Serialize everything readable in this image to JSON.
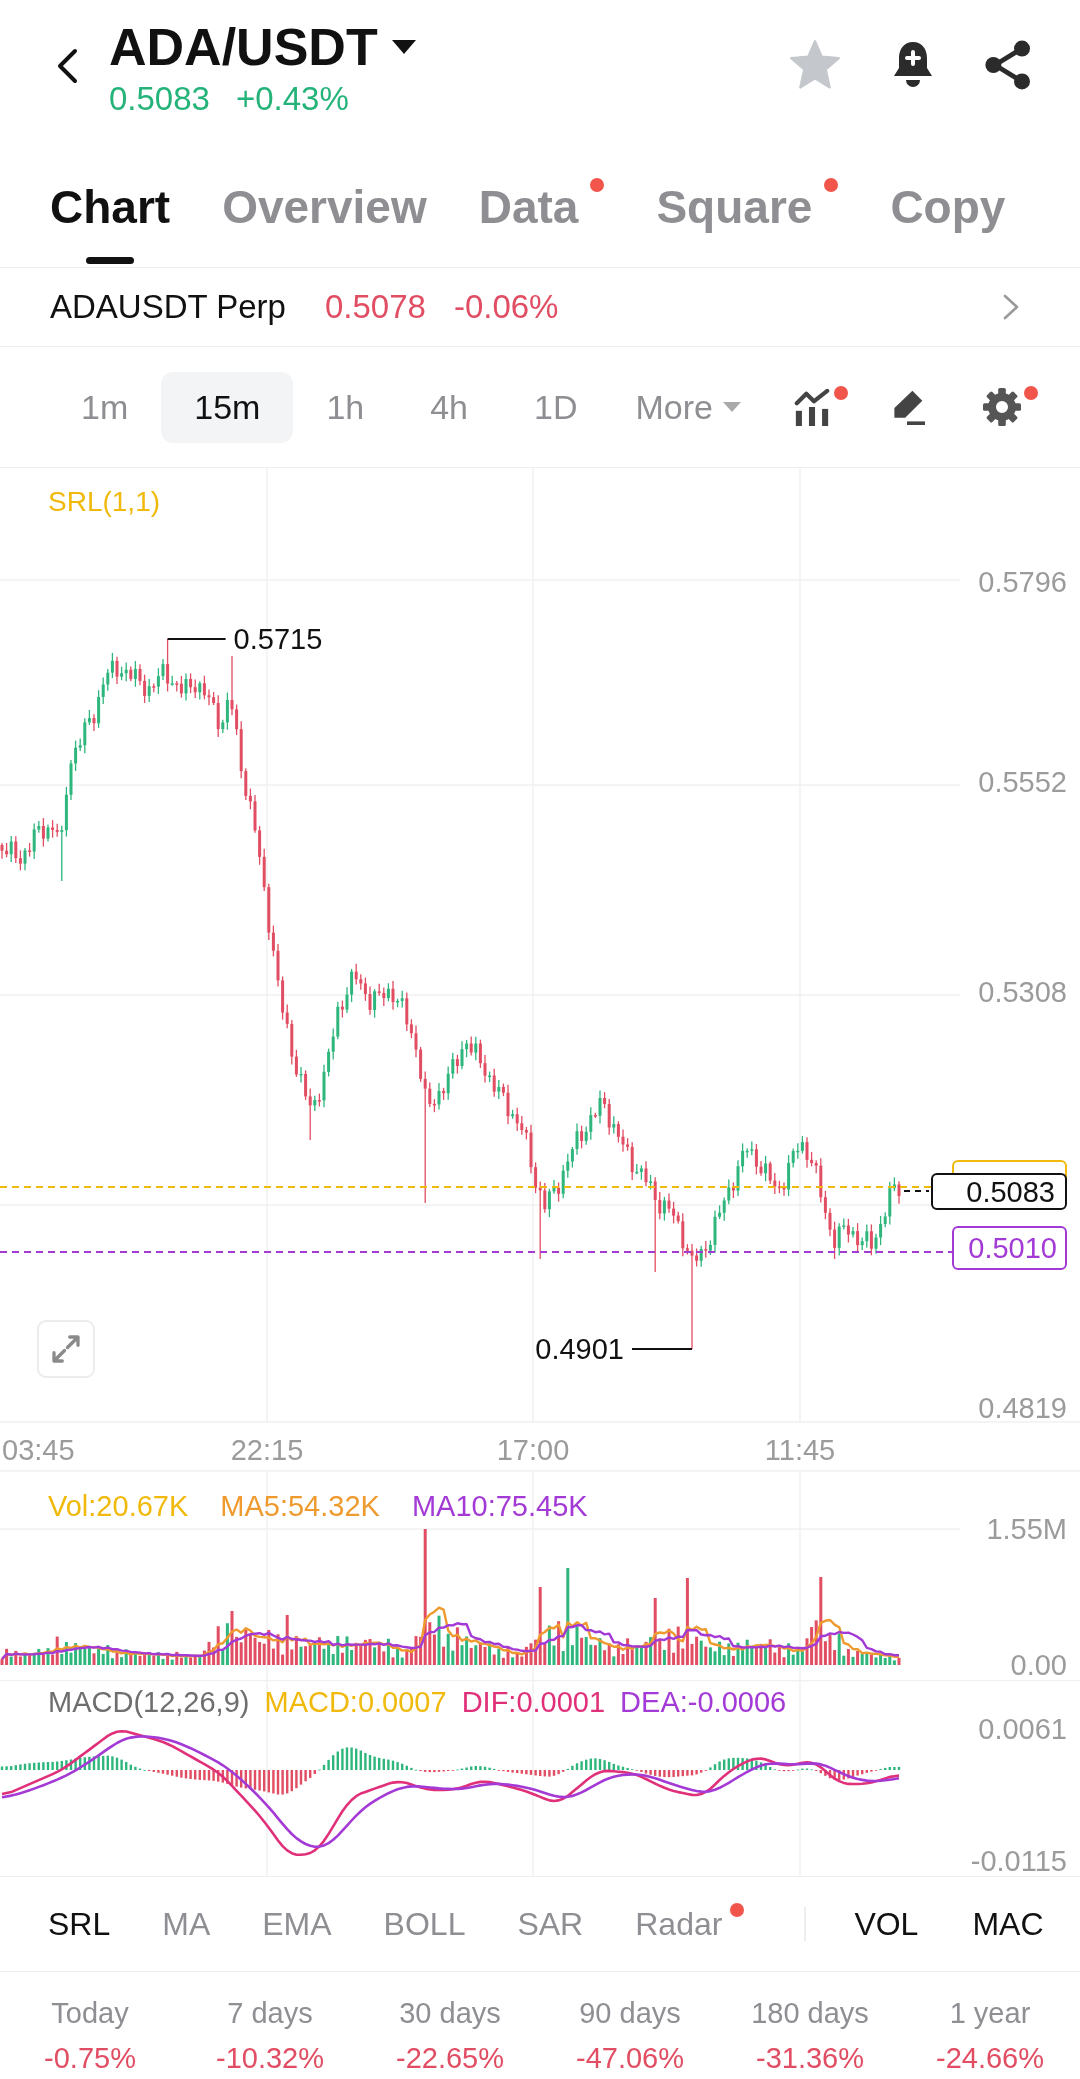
{
  "header": {
    "pair": "ADA/USDT",
    "price": "0.5083",
    "change": "+0.43%",
    "rising": true,
    "favorited": false
  },
  "tabs": [
    {
      "label": "Chart",
      "selected": true,
      "dot": false
    },
    {
      "label": "Overview",
      "selected": false,
      "dot": false
    },
    {
      "label": "Data",
      "selected": false,
      "dot": true
    },
    {
      "label": "Square",
      "selected": false,
      "dot": true
    },
    {
      "label": "Copy",
      "selected": false,
      "dot": false
    }
  ],
  "perpetual": {
    "name": "ADAUSDT Perp",
    "price": "0.5078",
    "change": "-0.06%",
    "rising": false
  },
  "timeframes": [
    {
      "label": "1m",
      "selected": false
    },
    {
      "label": "15m",
      "selected": true
    },
    {
      "label": "1h",
      "selected": false
    },
    {
      "label": "4h",
      "selected": false
    },
    {
      "label": "1D",
      "selected": false
    }
  ],
  "more_menu": {
    "label": "More"
  },
  "chart_tools": [
    {
      "kind": "indicators",
      "dot": true
    },
    {
      "kind": "draw",
      "dot": false
    },
    {
      "kind": "settings",
      "dot": true
    }
  ],
  "main_chart": {
    "indicator_label": "SRL(1,1)",
    "price_axis": [
      "0.5796",
      "0.5552",
      "0.5308",
      "0.4819"
    ],
    "time_axis": [
      "03:45",
      "22:15",
      "17:00",
      "11:45"
    ],
    "high_label": "0.5715",
    "low_label": "0.4901",
    "last_price_tag": "0.5083",
    "support_tag": "0.5010"
  },
  "volume_pane": {
    "legend": [
      {
        "text": "Vol:20.67K",
        "color": "#f0b90b"
      },
      {
        "text": "MA5:54.32K",
        "color": "#ee9a2e"
      },
      {
        "text": "MA10:75.45K",
        "color": "#a33ad6"
      }
    ],
    "axis": [
      "1.55M",
      "0.00"
    ]
  },
  "macd_pane": {
    "legend": [
      {
        "text": "MACD(12,26,9)",
        "color": "#6e6e6e"
      },
      {
        "text": "MACD:0.0007",
        "color": "#f0b90b"
      },
      {
        "text": "DIF:0.0001",
        "color": "#e0307a"
      },
      {
        "text": "DEA:-0.0006",
        "color": "#a33ad6"
      }
    ],
    "axis": [
      "0.0061",
      "-0.0115"
    ]
  },
  "main_indicators": [
    {
      "label": "SRL",
      "selected": true,
      "dot": false
    },
    {
      "label": "MA",
      "selected": false,
      "dot": false
    },
    {
      "label": "EMA",
      "selected": false,
      "dot": false
    },
    {
      "label": "BOLL",
      "selected": false,
      "dot": false
    },
    {
      "label": "SAR",
      "selected": false,
      "dot": false
    },
    {
      "label": "Radar",
      "selected": false,
      "dot": true
    }
  ],
  "sub_indicators": [
    {
      "label": "VOL",
      "selected": true
    },
    {
      "label": "MAC",
      "selected": true
    }
  ],
  "returns": [
    {
      "period": "Today",
      "value": "-0.75%",
      "rising": false
    },
    {
      "period": "7 days",
      "value": "-10.32%",
      "rising": false
    },
    {
      "period": "30 days",
      "value": "-22.65%",
      "rising": false
    },
    {
      "period": "90 days",
      "value": "-47.06%",
      "rising": false
    },
    {
      "period": "180 days",
      "value": "-31.36%",
      "rising": false
    },
    {
      "period": "1 year",
      "value": "-24.66%",
      "rising": false
    }
  ]
}
